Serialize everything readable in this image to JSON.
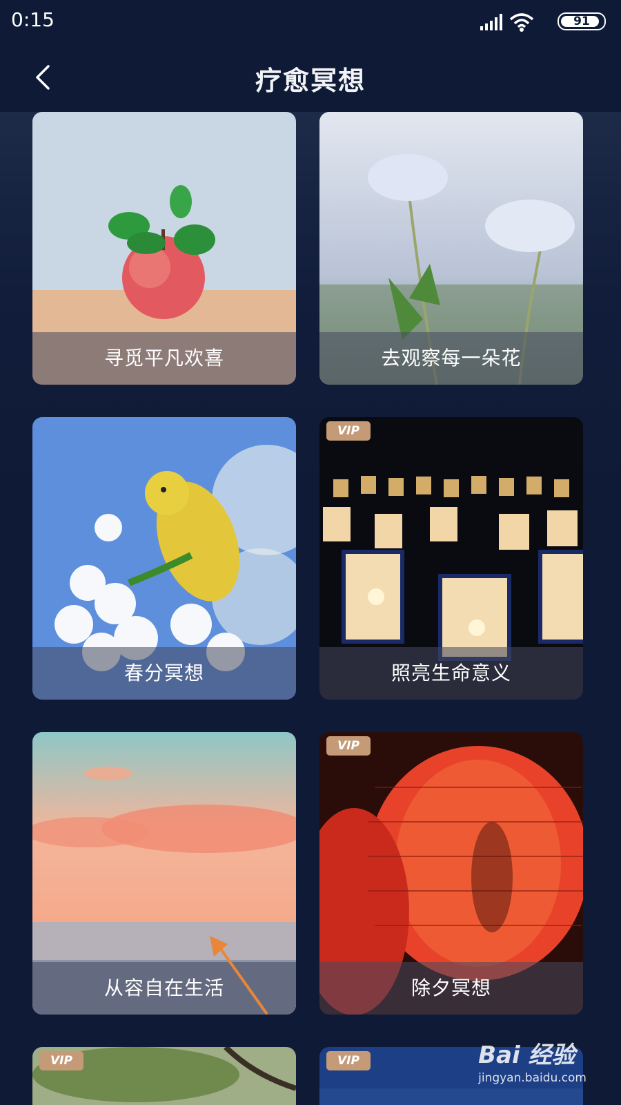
{
  "status_bar": {
    "time": "0:15",
    "battery_level": "91",
    "battery_fraction": 0.91,
    "icons": [
      "signal-icon",
      "wifi-icon",
      "battery-icon"
    ]
  },
  "header": {
    "back_icon": "chevron-left-icon",
    "title": "疗愈冥想"
  },
  "cards": [
    {
      "title": "寻觅平凡欢喜",
      "vip": false,
      "image": "red apple with green leaves"
    },
    {
      "title": "去观察每一朵花",
      "vip": false,
      "image": "pale blue flowers against sky"
    },
    {
      "title": "春分冥想",
      "vip": false,
      "image": "yellow bird on white blossoms"
    },
    {
      "title": "照亮生命意义",
      "vip": true,
      "vip_label": "VIP",
      "image": "rows of paper lanterns at night"
    },
    {
      "title": "从容自在生活",
      "vip": false,
      "image": "sunset sky over the sea"
    },
    {
      "title": "除夕冥想",
      "vip": true,
      "vip_label": "VIP",
      "image": "red paper lantern"
    },
    {
      "title": "",
      "vip": true,
      "vip_label": "VIP",
      "image": "tree branches"
    },
    {
      "title": "",
      "vip": true,
      "vip_label": "VIP",
      "image": "blue scene"
    }
  ],
  "watermark": {
    "logo": "Bai 经验",
    "url": "jingyan.baidu.com"
  },
  "colors": {
    "background": "#0f1a36",
    "vip_badge": "#c49a77",
    "caption_overlay": "#46485f",
    "annotation_arrow": "#e8863a"
  }
}
